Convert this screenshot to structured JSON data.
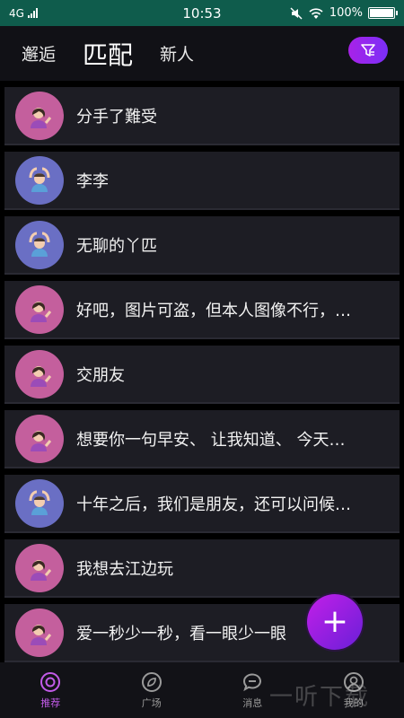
{
  "status_bar": {
    "network": "4G",
    "time": "10:53",
    "battery": "100%"
  },
  "header": {
    "tabs": [
      {
        "label": "邂逅"
      },
      {
        "label": "匹配"
      },
      {
        "label": "新人"
      }
    ],
    "active_tab": "匹配",
    "filter_icon": "filter-icon"
  },
  "list": {
    "items": [
      {
        "text": "分手了難受",
        "avatar": "woman-tipping-hand-emoji",
        "avatar_color": "#c45f9d"
      },
      {
        "text": "李李",
        "avatar": "person-gesturing-ok-emoji",
        "avatar_color": "#6a6fc4"
      },
      {
        "text": "无聊的丫匹",
        "avatar": "person-gesturing-ok-emoji",
        "avatar_color": "#6a6fc4"
      },
      {
        "text": "好吧，图片可盗，但本人图像不行，…",
        "avatar": "woman-tipping-hand-emoji",
        "avatar_color": "#c45f9d"
      },
      {
        "text": "交朋友",
        "avatar": "woman-tipping-hand-emoji",
        "avatar_color": "#c45f9d"
      },
      {
        "text": "想要你一句早安、 让我知道、 今天…",
        "avatar": "woman-tipping-hand-emoji",
        "avatar_color": "#c45f9d"
      },
      {
        "text": "十年之后，我们是朋友，还可以问候…",
        "avatar": "person-gesturing-ok-emoji",
        "avatar_color": "#6a6fc4"
      },
      {
        "text": "我想去江边玩",
        "avatar": "woman-tipping-hand-emoji",
        "avatar_color": "#c45f9d"
      },
      {
        "text": "爱一秒少一秒，看一眼少一眼",
        "avatar": "woman-tipping-hand-emoji",
        "avatar_color": "#c45f9d"
      }
    ]
  },
  "fab": {
    "label": "+"
  },
  "bottom_nav": {
    "items": [
      {
        "label": "推荐",
        "icon": "eye-icon"
      },
      {
        "label": "广场",
        "icon": "compass-icon"
      },
      {
        "label": "消息",
        "icon": "chat-bubble-icon"
      },
      {
        "label": "我的",
        "icon": "user-icon"
      }
    ],
    "active": "推荐",
    "active_color": "#c25be8"
  },
  "watermark": {
    "text": "一听下载"
  }
}
